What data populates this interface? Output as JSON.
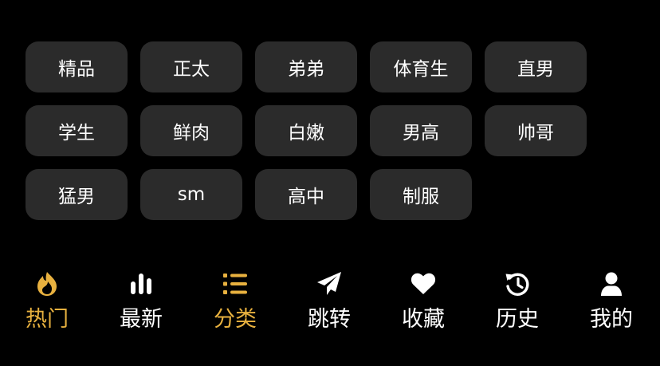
{
  "colors": {
    "background": "#000000",
    "tag_background": "#2b2b2b",
    "accent": "#e8b13f",
    "text": "#ffffff"
  },
  "tags": [
    "精品",
    "正太",
    "弟弟",
    "体育生",
    "直男",
    "学生",
    "鲜肉",
    "白嫩",
    "男高",
    "帅哥",
    "猛男",
    "sm",
    "高中",
    "制服"
  ],
  "tabbar": {
    "items": [
      {
        "label": "热门",
        "icon": "fire-icon",
        "active": true
      },
      {
        "label": "最新",
        "icon": "bar-chart-icon",
        "active": false
      },
      {
        "label": "分类",
        "icon": "list-icon",
        "active": true
      },
      {
        "label": "跳转",
        "icon": "paper-plane-icon",
        "active": false
      },
      {
        "label": "收藏",
        "icon": "heart-icon",
        "active": false
      },
      {
        "label": "历史",
        "icon": "history-icon",
        "active": false
      },
      {
        "label": "我的",
        "icon": "user-icon",
        "active": false
      }
    ]
  }
}
